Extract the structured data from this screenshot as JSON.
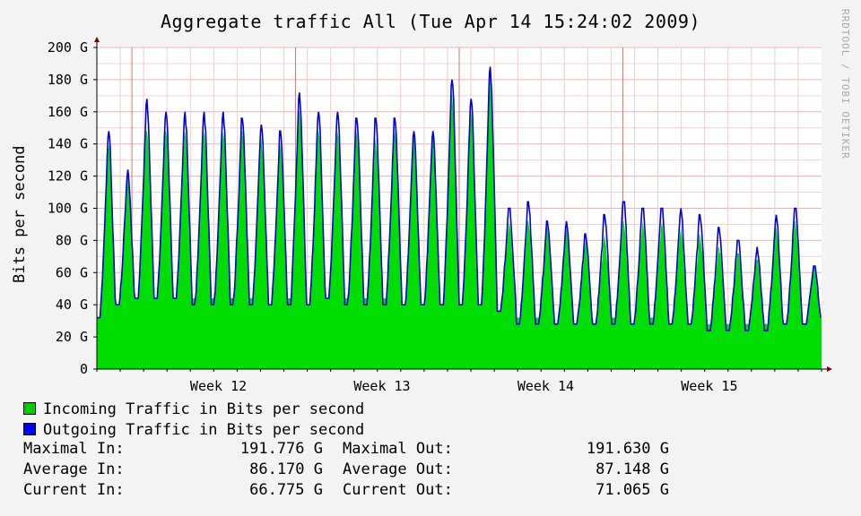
{
  "title": "Aggregate traffic All (Tue Apr 14 15:24:02 2009)",
  "watermark": "RRDTOOL / TOBI OETIKER",
  "legend": [
    {
      "label": "Incoming Traffic in Bits per second",
      "color": "#00cc00"
    },
    {
      "label": "Outgoing Traffic in Bits per second",
      "color": "#0000ff"
    }
  ],
  "stats": [
    {
      "label_in": "Maximal In:",
      "value_in": "191.776 G",
      "label_out": "Maximal Out:",
      "value_out": "191.630 G"
    },
    {
      "label_in": "Average In:",
      "value_in": "86.170 G",
      "label_out": "Average Out:",
      "value_out": "87.148 G"
    },
    {
      "label_in": "Current In:",
      "value_in": "66.775 G",
      "label_out": "Current Out:",
      "value_out": "71.065 G"
    }
  ],
  "chart_data": {
    "type": "area",
    "title": "Aggregate traffic All (Tue Apr 14 15:24:02 2009)",
    "ylabel": "Bits per second",
    "xlabel": "",
    "ylim": [
      0,
      200
    ],
    "y_ticks": [
      0,
      20,
      40,
      60,
      80,
      100,
      120,
      140,
      160,
      180,
      200
    ],
    "y_tick_labels": [
      "0",
      "20 G",
      "40 G",
      "60 G",
      "80 G",
      "100 G",
      "120 G",
      "140 G",
      "160 G",
      "180 G",
      "200 G"
    ],
    "x_labels": [
      {
        "label": "Week 12",
        "day": 5.2
      },
      {
        "label": "Week 13",
        "day": 12.2
      },
      {
        "label": "Week 14",
        "day": 19.2
      },
      {
        "label": "Week 15",
        "day": 26.2
      }
    ],
    "x_range_days": [
      0,
      31
    ],
    "grid": true,
    "series": [
      {
        "name": "Incoming Traffic in Bits per second",
        "color": "#00cc00",
        "daily_peaks": [
          143,
          125,
          152,
          153,
          150,
          151,
          150,
          153,
          145,
          142,
          165,
          153,
          150,
          150,
          145,
          150,
          148,
          145,
          175,
          165,
          185,
          92,
          95,
          90,
          88,
          80,
          84,
          95,
          92,
          92,
          88,
          86,
          78,
          75,
          70,
          90,
          95,
          65
        ],
        "daily_troughs": [
          32,
          40,
          45,
          45,
          44,
          43,
          43,
          43,
          42,
          41,
          42,
          40,
          45,
          43,
          42,
          42,
          40,
          40,
          40,
          40,
          40,
          36,
          30,
          30,
          28,
          28,
          28,
          30,
          28,
          30,
          28,
          28,
          26,
          26,
          26,
          26,
          28,
          28
        ],
        "baseline": {
          "before_week14": 44,
          "after_week14": 33
        }
      },
      {
        "name": "Outgoing Traffic in Bits per second",
        "color": "#0000ff",
        "daily_peaks": [
          150,
          125,
          170,
          163,
          162,
          162,
          162,
          160,
          155,
          152,
          175,
          164,
          163,
          161,
          160,
          160,
          150,
          150,
          185,
          172,
          192,
          104,
          106,
          94,
          92,
          86,
          98,
          108,
          104,
          104,
          101,
          98,
          90,
          83,
          76,
          96,
          104,
          66
        ],
        "daily_troughs": [
          30,
          38,
          43,
          43,
          42,
          41,
          41,
          41,
          40,
          39,
          40,
          38,
          43,
          41,
          40,
          40,
          38,
          38,
          38,
          38,
          38,
          34,
          28,
          28,
          26,
          26,
          26,
          28,
          26,
          28,
          26,
          26,
          24,
          24,
          24,
          24,
          26,
          26
        ]
      }
    ]
  }
}
